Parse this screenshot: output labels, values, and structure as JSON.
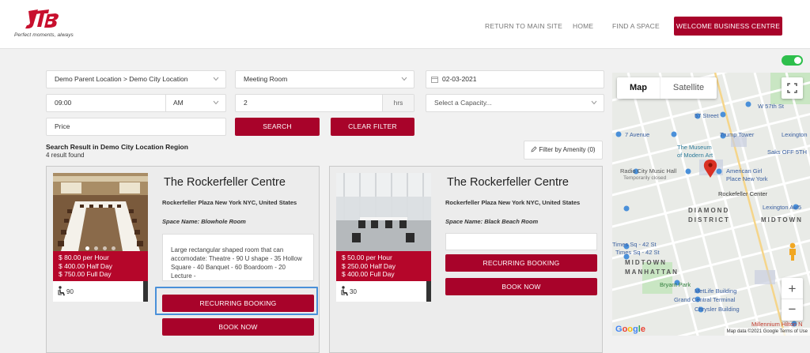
{
  "header": {
    "logo_text": "JTB",
    "tagline": "Perfect moments, always",
    "nav": [
      {
        "label": "RETURN TO MAIN SITE"
      },
      {
        "label": "HOME"
      },
      {
        "label": "FIND A SPACE"
      }
    ],
    "welcome_button": "WELCOME BUSINESS CENTRE",
    "brand_color": "#a8032a"
  },
  "map_toggle": {
    "on": true,
    "color": "#2ebf4c"
  },
  "search_form": {
    "location": "Demo Parent Location > Demo City Location",
    "room_type": "Meeting Room",
    "date": "02-03-2021",
    "time": "09:00",
    "meridiem": "AM",
    "duration": "2",
    "duration_unit": "hrs",
    "capacity_placeholder": "Select a Capacity...",
    "price_placeholder": "Price",
    "search_button": "SEARCH",
    "clear_button": "CLEAR FILTER"
  },
  "results": {
    "title": "Search Result in Demo City Location Region",
    "count": "4 result found",
    "filter_amenity": "Filter by Amenity (0)"
  },
  "cards": [
    {
      "name": "The Rockerfeller Centre",
      "address": "Rockerfeller Plaza New York NYC, United States",
      "space": "Space Name: Blowhole Room",
      "prices": [
        "$ 80.00 per Hour",
        "$ 400.00 Half Day",
        "$ 750.00 Full Day"
      ],
      "capacity": "90",
      "description": "Large rectangular shaped room that can accomodate: Theatre - 90 U shape - 35 Hollow Square - 40 Banquet - 60 Boardoom - 20 Lecture -",
      "recurring_button": "RECURRING BOOKING",
      "book_button": "BOOK NOW"
    },
    {
      "name": "The Rockerfeller Centre",
      "address": "Rockerfeller Plaza New York NYC, United States",
      "space": "Space Name: Black Beach Room",
      "prices": [
        "$ 50.00 per Hour",
        "$ 250.00 Half Day",
        "$ 400.00 Full Day"
      ],
      "capacity": "30",
      "description": "",
      "recurring_button": "RECURRING BOOKING",
      "book_button": "BOOK NOW"
    }
  ],
  "map": {
    "tab_map": "Map",
    "tab_satellite": "Satellite",
    "labels": {
      "w57": "57 Street",
      "w57b": "W 57th St",
      "ave7": "7 Avenue",
      "trump": "Trump Tower",
      "lexington": "Lexington",
      "saks": "Saks OFF 5TH",
      "moma1": "The Museum",
      "moma2": "of Modern Art",
      "radio1": "Radio City Music Hall",
      "radio2": "Temporarily closed",
      "ag1": "American Girl",
      "ag2": "Place New York",
      "rock": "Rockefeller Center",
      "diamond": "DIAMOND",
      "district": "DISTRICT",
      "midtown": "MIDTOWN",
      "lex2": "Lexington Av/5",
      "times1": "Times Sq - 42 St",
      "times2": "Times Sq - 42 St",
      "mm1": "MIDTOWN",
      "mm2": "MANHATTAN",
      "bryant": "Bryant Park",
      "metlife": "MetLife Building",
      "gct": "Grand Central Terminal",
      "chrysler": "Chrysler Building",
      "millennium": "Millennium Hilton N"
    },
    "credits": "Map data ©2021 Google  Terms of Use",
    "google": "Google"
  }
}
